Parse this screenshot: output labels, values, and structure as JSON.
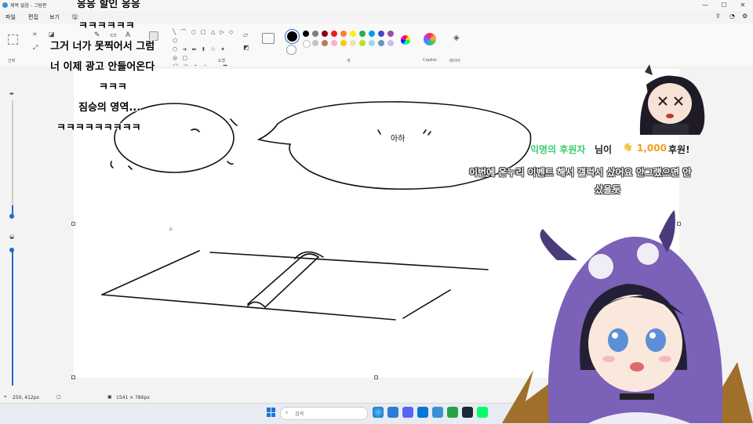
{
  "window": {
    "title": "제목 없음 - 그림판",
    "buttons": [
      "—",
      "☐",
      "✕"
    ]
  },
  "menu": {
    "items": [
      "파일",
      "편집",
      "보기"
    ]
  },
  "ribbon": {
    "groups": {
      "select": "선택",
      "shapes": "도형",
      "colors": "색",
      "copilot": "Copilot",
      "layers": "레이어"
    },
    "palette": [
      "#000000",
      "#7f7f7f",
      "#880015",
      "#ed1c24",
      "#ff7f27",
      "#fff200",
      "#22b14c",
      "#00a2e8",
      "#3f48cc",
      "#a349a4",
      "#ffffff",
      "#c3c3c3",
      "#b97a57",
      "#ffaec9",
      "#ffc90e",
      "#efe4b0",
      "#b5e61d",
      "#99d9ea",
      "#7092be",
      "#c8bfe7"
    ],
    "accent": "#1a6fc2"
  },
  "canvas": {
    "speech_text": "아하"
  },
  "status": {
    "cursor_pos": "250, 412px",
    "canvas_size": "1541 × 786px"
  },
  "taskbar": {
    "search_placeholder": "검색"
  },
  "chat": {
    "lines": [
      "응응 할인 응응",
      "ㅋㅋㅋㅋㅋㅋ",
      "그거 너가 못찍어서 그럼",
      "너 이제 광고 안들어온다",
      "ㅋㅋㅋ",
      "짐승의 영역...",
      "ㅋㅋㅋㅋㅋㅋㅋㅋㅋ"
    ]
  },
  "donation": {
    "donor": "익명의 후원자",
    "suffix": "님이",
    "amount": "1,000",
    "unit": "후원!",
    "message_line1": "이번에 온누리 이벤트 해서 갤럭시 샀어요 안그랬으면 안",
    "message_line2": "샀을듯"
  }
}
